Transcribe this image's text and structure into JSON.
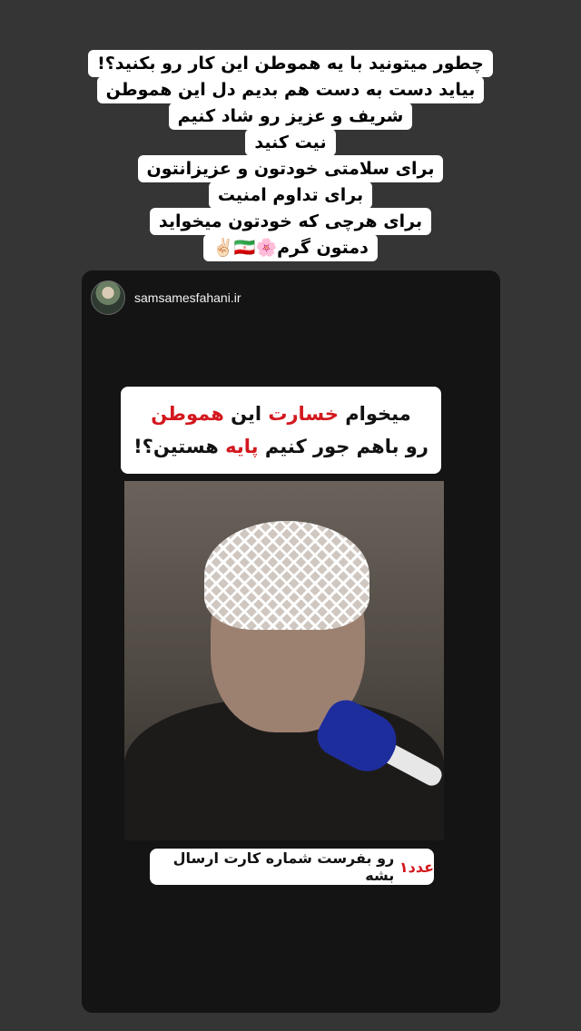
{
  "caption": {
    "lines": [
      "چطور میتونید با یه هموطن این کار رو بکنید؟!",
      "بیاید دست به دست هم بدیم دل این هموطن",
      "شریف و عزیز رو شاد کنیم",
      "نیت کنید",
      "برای سلامتی خودتون و عزیزانتون",
      "برای تداوم امنیت",
      "برای هرچی که خودتون میخواید",
      "دمتون گرم🌸🇮🇷✌🏻"
    ]
  },
  "post": {
    "username": "samsamesfahani.ir",
    "headline": {
      "line1_part1": "میخوام",
      "line1_red1": "خسارت",
      "line1_part2": "این",
      "line1_red2": "هموطن",
      "line2_part1": "رو باهم جور کنیم",
      "line2_red": "پایه",
      "line2_part2": "هستین؟!"
    },
    "footer": {
      "red": "عدد۱",
      "text": "رو بفرست شماره کارت ارسال بشه"
    }
  }
}
